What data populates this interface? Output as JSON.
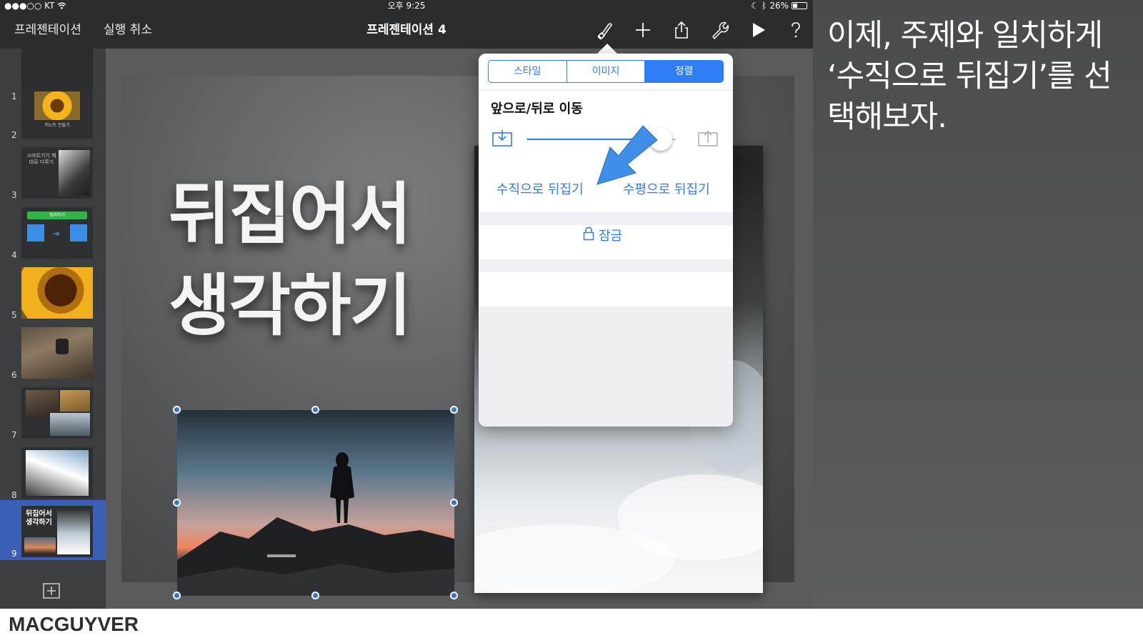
{
  "status_bar": {
    "carrier": "●●●○○ KT",
    "time": "오후 9:25",
    "battery": "26%"
  },
  "toolbar": {
    "presentations_label": "프레젠테이션",
    "undo_label": "실행 취소",
    "document_title": "프레젠테이션 4"
  },
  "navigator": {
    "slides": [
      {
        "num": "1",
        "caption": ""
      },
      {
        "num": "2",
        "caption": "키노트 만들기"
      },
      {
        "num": "3",
        "caption": "스마트기기 제대로 다루기"
      },
      {
        "num": "4",
        "caption": "정리하기"
      },
      {
        "num": "5",
        "caption": ""
      },
      {
        "num": "6",
        "caption": ""
      },
      {
        "num": "7",
        "caption": ""
      },
      {
        "num": "8",
        "caption": ""
      },
      {
        "num": "9",
        "caption": "뒤집어서 생각하기"
      }
    ],
    "active_slide": 9
  },
  "slide": {
    "headline_line1": "뒤집어서",
    "headline_line2": "생각하기"
  },
  "popover": {
    "tabs": [
      "스타일",
      "이미지",
      "정렬"
    ],
    "selected_tab": "정렬",
    "move_section_title": "앞으로/뒤로 이동",
    "layer_slider_value": 0.9,
    "flip_vertical_label": "수직으로 뒤집기",
    "flip_horizontal_label": "수평으로 뒤집기",
    "lock_label": "잠금"
  },
  "commentary": {
    "text": "이제, 주제와 일치하게 ‘수직으로 뒤집기’를 선택해보자."
  },
  "brand": "MACGUYVER",
  "colors": {
    "accent": "#2e7cf6",
    "toolbar_bg": "#2b2c2e",
    "selected_slide_bg": "#3a5fb5",
    "arrow": "#3d8fe8"
  },
  "icons": {
    "format": "paintbrush-icon",
    "insert": "plus-icon",
    "share": "share-icon",
    "tools": "wrench-icon",
    "play": "play-icon",
    "help": "question-icon",
    "send_backward": "send-backward-icon",
    "bring_forward": "bring-forward-icon",
    "lock": "lock-icon",
    "add_slide": "add-slide-icon"
  }
}
